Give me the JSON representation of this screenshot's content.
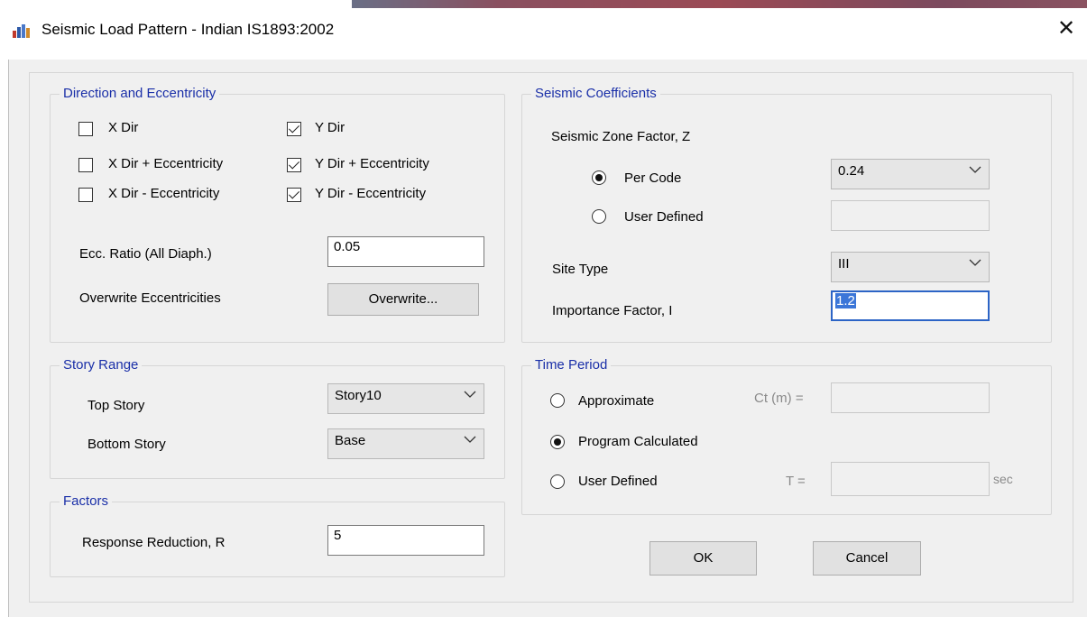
{
  "window": {
    "title": "Seismic Load Pattern - Indian IS1893:2002",
    "app_icon": "etabs-building-icon",
    "close_glyph": "✕"
  },
  "direction": {
    "legend": "Direction and Eccentricity",
    "x_dir": {
      "label": "X Dir",
      "checked": false
    },
    "x_dir_plus": {
      "label": "X Dir + Eccentricity",
      "checked": false
    },
    "x_dir_minus": {
      "label": "X Dir - Eccentricity",
      "checked": false
    },
    "y_dir": {
      "label": "Y Dir",
      "checked": true
    },
    "y_dir_plus": {
      "label": "Y Dir + Eccentricity",
      "checked": true
    },
    "y_dir_minus": {
      "label": "Y Dir - Eccentricity",
      "checked": true
    },
    "ecc_ratio_label": "Ecc. Ratio (All Diaph.)",
    "ecc_ratio_value": "0.05",
    "overwrite_label": "Overwrite Eccentricities",
    "overwrite_button": "Overwrite..."
  },
  "story_range": {
    "legend": "Story Range",
    "top_label": "Top Story",
    "top_value": "Story10",
    "bottom_label": "Bottom Story",
    "bottom_value": "Base"
  },
  "factors": {
    "legend": "Factors",
    "r_label": "Response Reduction, R",
    "r_value": "5"
  },
  "coefficients": {
    "legend": "Seismic Coefficients",
    "zone_label": "Seismic Zone Factor, Z",
    "per_code_label": "Per Code",
    "per_code_selected": true,
    "per_code_value": "0.24",
    "user_defined_label": "User Defined",
    "user_defined_selected": false,
    "user_defined_value": "",
    "site_type_label": "Site Type",
    "site_type_value": "III",
    "importance_label": "Importance Factor, I",
    "importance_value": "1.2"
  },
  "time_period": {
    "legend": "Time Period",
    "approx_label": "Approximate",
    "approx_selected": false,
    "ct_label": "Ct (m) =",
    "ct_value": "",
    "program_label": "Program Calculated",
    "program_selected": true,
    "user_label": "User Defined",
    "user_selected": false,
    "t_label": "T =",
    "t_value": "",
    "t_unit": "sec"
  },
  "buttons": {
    "ok": "OK",
    "cancel": "Cancel"
  },
  "colors": {
    "legend_text": "#1a2fa8",
    "focus_border": "#2c64c6",
    "selection": "#3b76d8",
    "dialog_bg": "#f0f0f0"
  }
}
